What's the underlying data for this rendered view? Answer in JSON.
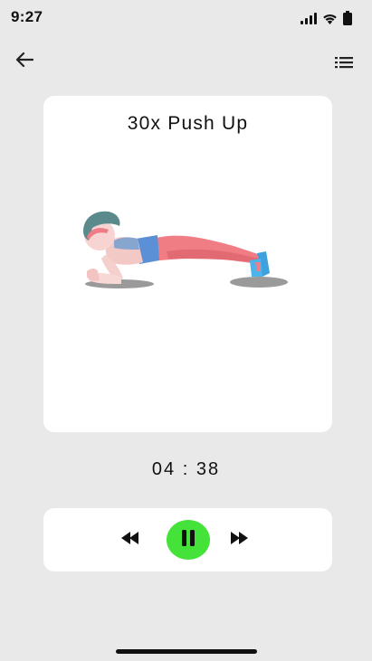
{
  "status_bar": {
    "time": "9:27",
    "icons": [
      "signal-icon",
      "wifi-icon",
      "battery-icon"
    ]
  },
  "top_bar": {
    "back_icon": "arrow-back-icon",
    "menu_icon": "list-icon"
  },
  "exercise": {
    "title": "30x Push Up",
    "illustration": "plank-exercise-illustration"
  },
  "timer": {
    "display": "04 : 38"
  },
  "controls": {
    "rewind_icon": "rewind-icon",
    "pause_icon": "pause-icon",
    "forward_icon": "fast-forward-icon",
    "accent_color": "#45e23a"
  },
  "colors": {
    "background": "#e9e9e9",
    "card": "#ffffff"
  }
}
